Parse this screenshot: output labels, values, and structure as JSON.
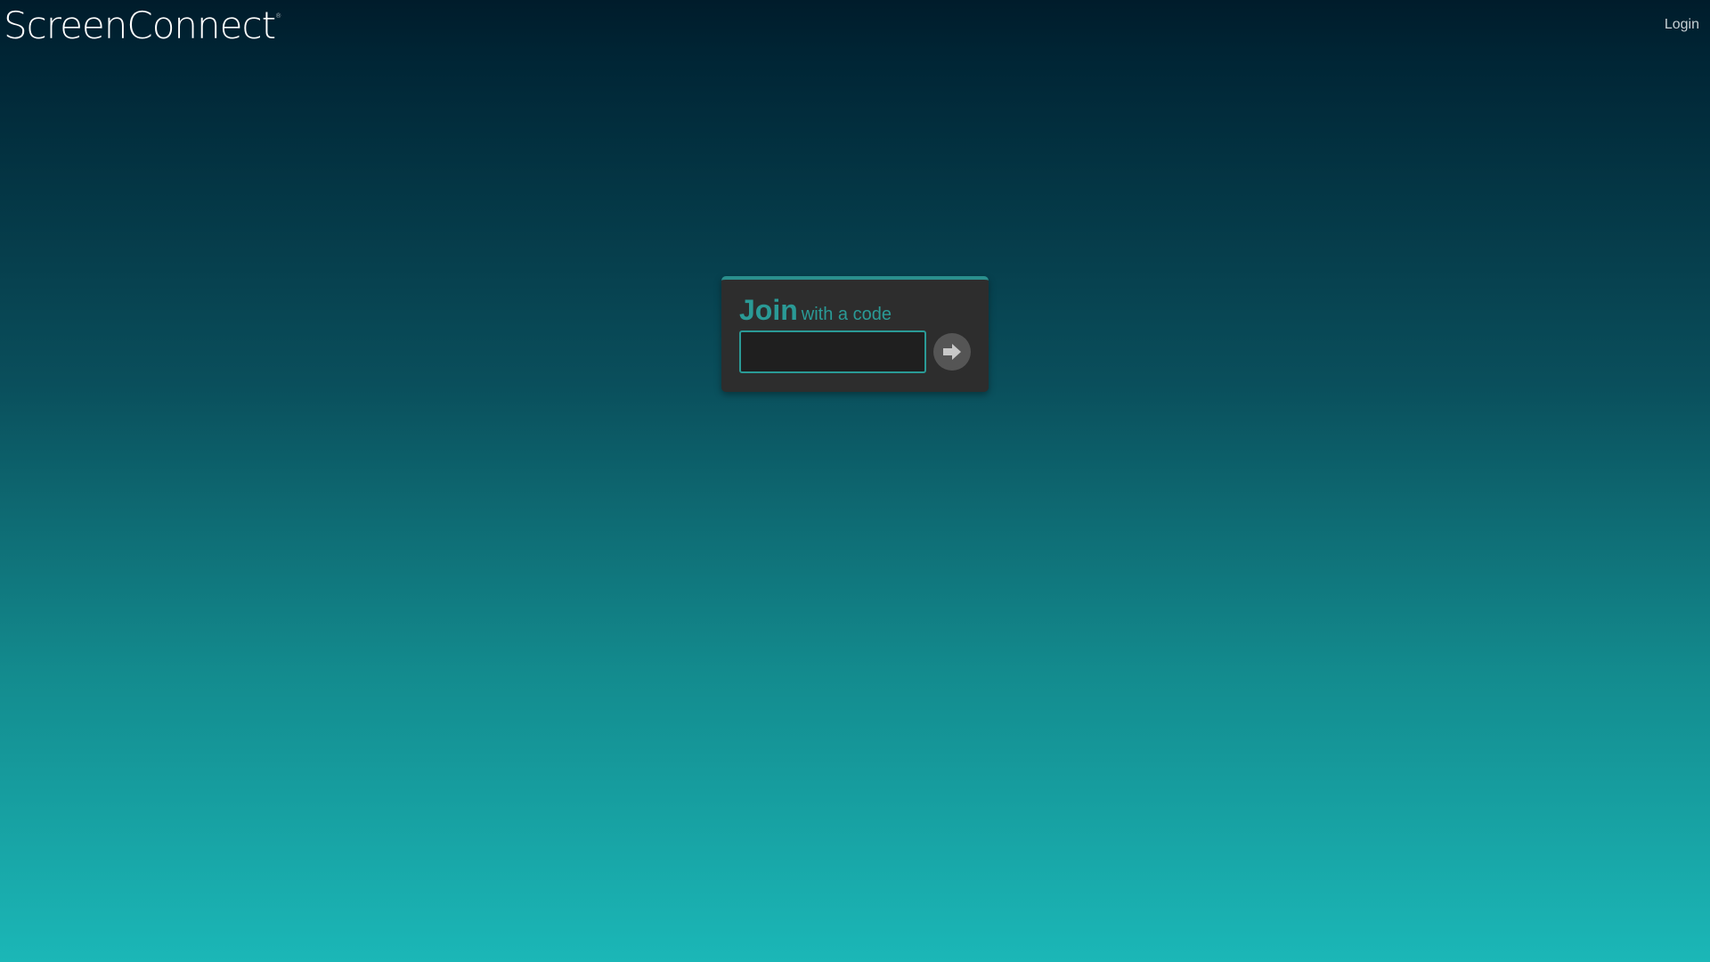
{
  "header": {
    "logo_text": "ScreenConnect",
    "logo_mark": "®",
    "login_label": "Login"
  },
  "join": {
    "title": "Join",
    "subtitle": "with a code",
    "code_value": "",
    "submit_icon": "arrow-right-icon"
  },
  "colors": {
    "accent": "#2a9a96",
    "card": "#2d2d2d",
    "input": "#1f1f1f",
    "button": "#555555"
  }
}
